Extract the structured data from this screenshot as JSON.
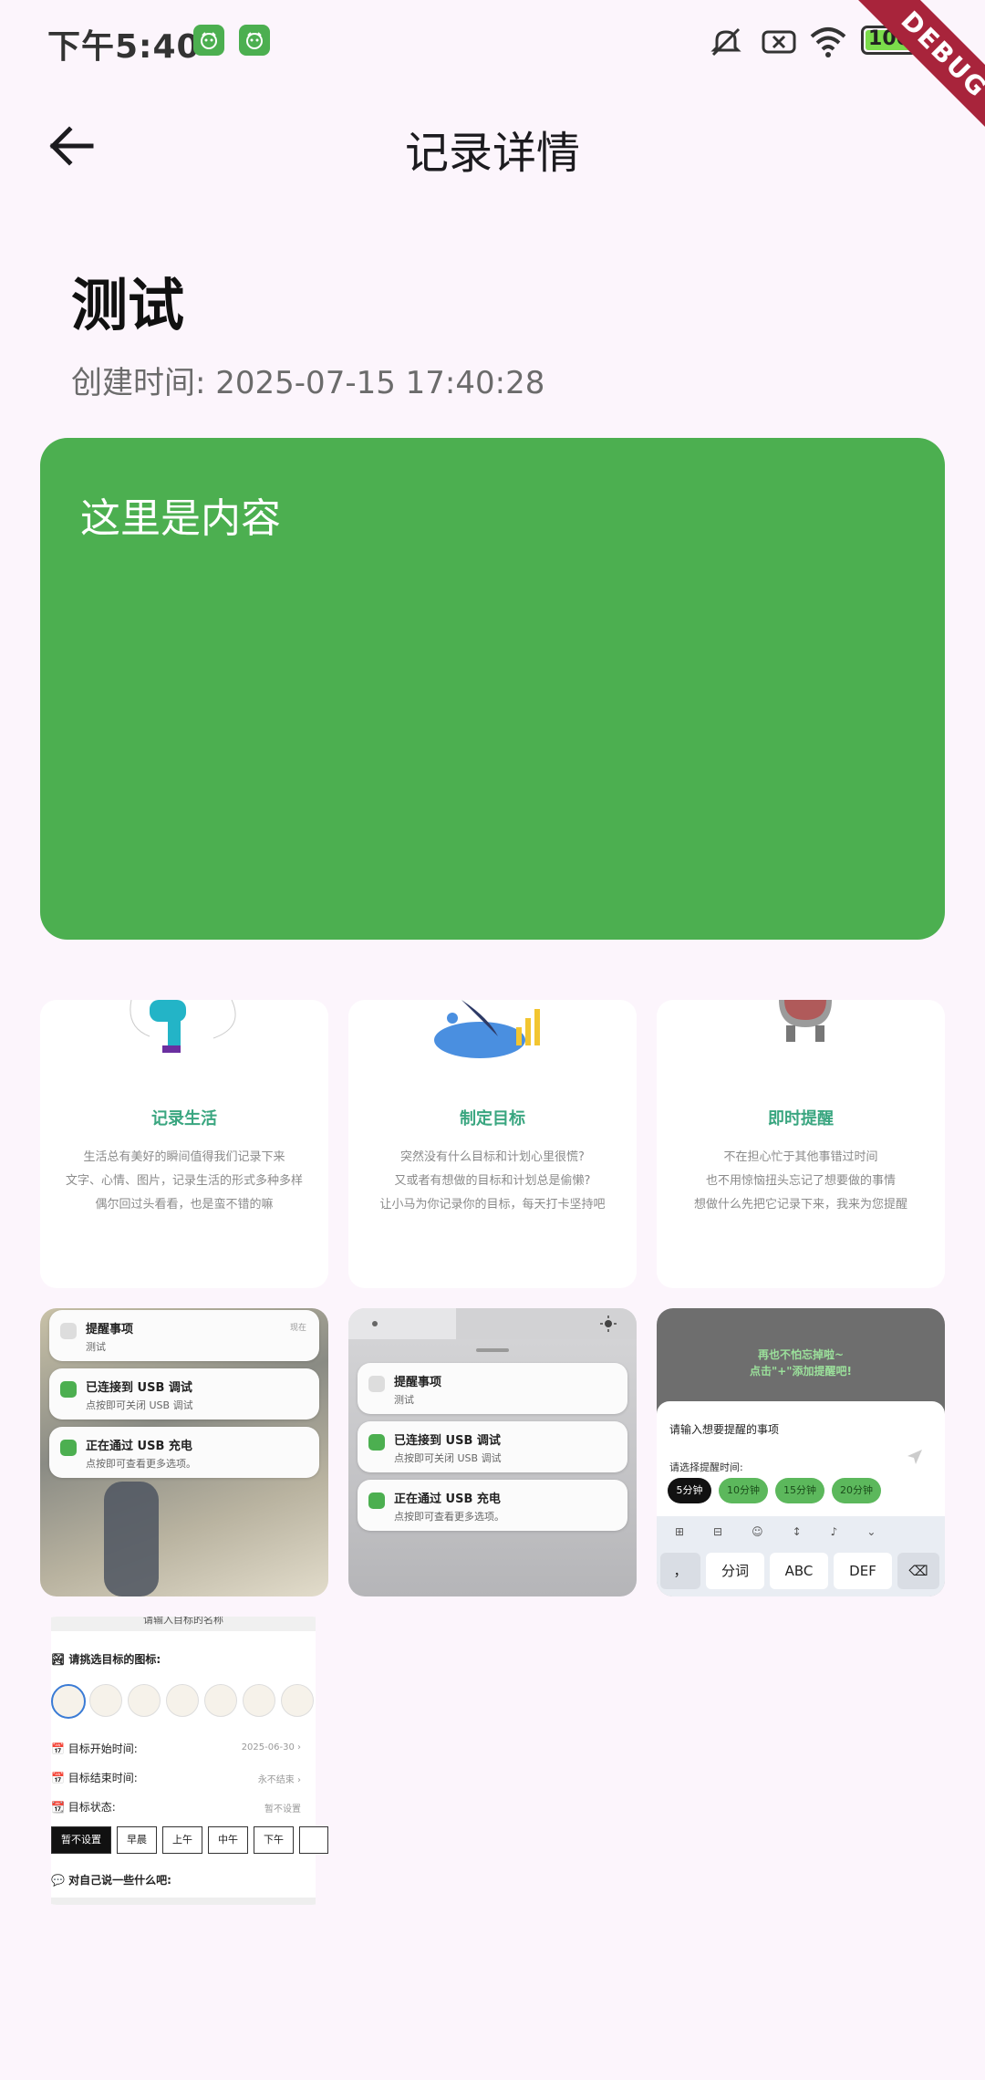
{
  "status_bar": {
    "time": "下午5:40",
    "battery": "100",
    "debug_banner": "DEBUG",
    "icons": [
      "app-badge-icon",
      "app-badge-icon",
      "mute-icon",
      "sim-off-icon",
      "wifi-icon",
      "battery-icon",
      "charging-icon"
    ]
  },
  "app_bar": {
    "title": "记录详情",
    "back_icon": "arrow-left-icon"
  },
  "record": {
    "title": "测试",
    "created_at": "创建时间: 2025-07-15 17:40:28",
    "content": "这里是内容",
    "card_color": "#4caf50"
  },
  "images": {
    "feature_cards": [
      {
        "title": "记录生活",
        "desc": [
          "生活总有美好的瞬间值得我们记录下来",
          "文字、心情、图片，记录生活的形式多种多样",
          "偶尔回过头看看，也是蛮不错的嘛"
        ]
      },
      {
        "title": "制定目标",
        "desc": [
          "突然没有什么目标和计划心里很慌?",
          "又或者有想做的目标和计划总是偷懒?",
          "让小马为你记录你的目标，每天打卡坚持吧"
        ]
      },
      {
        "title": "即时提醒",
        "desc": [
          "不在担心忙于其他事错过时间",
          "也不用惊恼扭头忘记了想要做的事情",
          "想做什么先把它记录下来，我来为您提醒"
        ]
      }
    ],
    "notifications": [
      {
        "title": "提醒事项",
        "sub": "测试",
        "meta": "现在"
      },
      {
        "title": "已连接到 USB 调试",
        "sub": "点按即可关闭 USB 调试"
      },
      {
        "title": "正在通过 USB 充电",
        "sub": "点按即可查看更多选项。"
      }
    ],
    "reminder_screen": {
      "banner": [
        "再也不怕忘掉啦~",
        "点击\"+\"添加提醒吧!"
      ],
      "input_label": "请输入想要提醒的事项",
      "time_label": "请选择提醒时间:",
      "chips": [
        "5分钟",
        "10分钟",
        "15分钟",
        "20分钟"
      ],
      "keys": [
        "，",
        "分词",
        "ABC",
        "DEF"
      ]
    },
    "goal_form": {
      "header": "请输入目标的名称",
      "icon_label": "请挑选目标的图标:",
      "start_label": "目标开始时间:",
      "start_value": "2025-06-30",
      "end_label": "目标结束时间:",
      "end_value": "永不结束",
      "state_label": "目标状态:",
      "state_value": "暂不设置",
      "state_options": [
        "暂不设置",
        "早晨",
        "上午",
        "中午",
        "下午"
      ],
      "note_label": "对自己说一些什么吧:"
    }
  }
}
